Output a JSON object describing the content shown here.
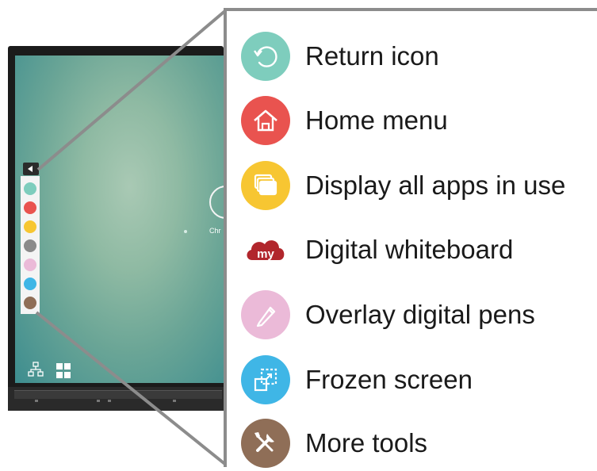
{
  "monitor": {
    "partial_app_label": "Chr",
    "bottom_icons": [
      {
        "name": "network-icon"
      },
      {
        "name": "windows-icon"
      }
    ]
  },
  "menu": {
    "items": [
      {
        "label": "Return icon",
        "icon": "return-icon",
        "color": "#7ecdbd"
      },
      {
        "label": "Home menu",
        "icon": "home-icon",
        "color": "#e9534f"
      },
      {
        "label": "Display all apps in use",
        "icon": "apps-icon",
        "color": "#f7c632"
      },
      {
        "label": "Digital whiteboard",
        "icon": "myviewboard-icon",
        "color": "#b1262c"
      },
      {
        "label": "Overlay digital pens",
        "icon": "pen-icon",
        "color": "#ebbad8"
      },
      {
        "label": "Frozen screen",
        "icon": "freeze-icon",
        "color": "#3fb6e6"
      },
      {
        "label": "More tools",
        "icon": "tools-icon",
        "color": "#8f6e57"
      }
    ],
    "mini_colors": [
      "#7ecdbd",
      "#e9534f",
      "#f7c632",
      "#8a8a8a",
      "#ebbad8",
      "#3fb6e6",
      "#8f6e57"
    ]
  }
}
